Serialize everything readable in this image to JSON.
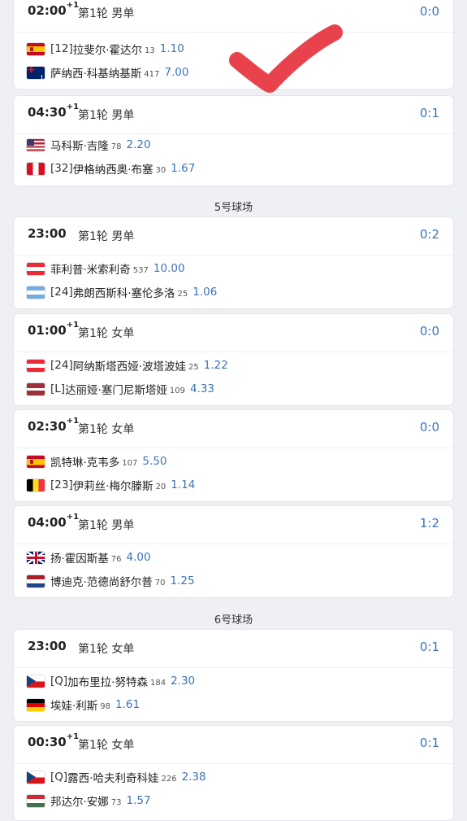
{
  "sections": {
    "court5": "5号球场",
    "court6": "6号球场"
  },
  "matches": [
    {
      "time": "02:00",
      "plus": "+1",
      "round": "第1轮 男单",
      "score": "0:0",
      "p1": {
        "flag": "spain",
        "seed": "[12] ",
        "name": "拉斐尔·霍达尔",
        "rank": "13",
        "odds": "1.10"
      },
      "p2": {
        "flag": "australia",
        "seed": "",
        "name": "萨纳西·科基纳基斯",
        "rank": "417",
        "odds": "7.00"
      }
    },
    {
      "time": "04:30",
      "plus": "+1",
      "round": "第1轮 男单",
      "score": "0:1",
      "p1": {
        "flag": "usa",
        "seed": "",
        "name": "马科斯·吉隆",
        "rank": "78",
        "odds": "2.20"
      },
      "p2": {
        "flag": "peru",
        "seed": "[32] ",
        "name": "伊格纳西奥·布塞",
        "rank": "30",
        "odds": "1.67"
      }
    },
    {
      "time": "23:00",
      "plus": "",
      "round": "第1轮 男单",
      "score": "0:2",
      "p1": {
        "flag": "austria",
        "seed": "",
        "name": "菲利普·米索利奇",
        "rank": "537",
        "odds": "10.00"
      },
      "p2": {
        "flag": "argentina",
        "seed": "[24] ",
        "name": "弗朗西斯科·塞伦多洛",
        "rank": "25",
        "odds": "1.06"
      }
    },
    {
      "time": "01:00",
      "plus": "+1",
      "round": "第1轮 女单",
      "score": "0:0",
      "p1": {
        "flag": "austria",
        "seed": "[24] ",
        "name": "阿纳斯塔西娅·波塔波娃",
        "rank": "25",
        "odds": "1.22"
      },
      "p2": {
        "flag": "latvia",
        "seed": "[L] ",
        "name": "达丽娅·塞门尼斯塔娅",
        "rank": "109",
        "odds": "4.33"
      }
    },
    {
      "time": "02:30",
      "plus": "+1",
      "round": "第1轮 女单",
      "score": "0:0",
      "p1": {
        "flag": "spain",
        "seed": "",
        "name": "凯特琳·克韦多",
        "rank": "107",
        "odds": "5.50"
      },
      "p2": {
        "flag": "belgium",
        "seed": "[23] ",
        "name": "伊莉丝·梅尔滕斯",
        "rank": "20",
        "odds": "1.14"
      }
    },
    {
      "time": "04:00",
      "plus": "+1",
      "round": "第1轮 男单",
      "score": "1:2",
      "p1": {
        "flag": "uk",
        "seed": "",
        "name": "扬·霍因斯基",
        "rank": "76",
        "odds": "4.00"
      },
      "p2": {
        "flag": "netherlands",
        "seed": "",
        "name": "博迪克·范德尚舒尔普",
        "rank": "70",
        "odds": "1.25"
      }
    },
    {
      "time": "23:00",
      "plus": "",
      "round": "第1轮 女单",
      "score": "0:1",
      "p1": {
        "flag": "czech",
        "seed": "[Q] ",
        "name": "加布里拉·努特森",
        "rank": "184",
        "odds": "2.30"
      },
      "p2": {
        "flag": "germany",
        "seed": "",
        "name": "埃娃·利斯",
        "rank": "98",
        "odds": "1.61"
      }
    },
    {
      "time": "00:30",
      "plus": "+1",
      "round": "第1轮 女单",
      "score": "0:1",
      "p1": {
        "flag": "czech",
        "seed": "[Q] ",
        "name": "露西·哈夫利奇科娃",
        "rank": "226",
        "odds": "2.38"
      },
      "p2": {
        "flag": "hungary",
        "seed": "",
        "name": "邦达尔·安娜",
        "rank": "73",
        "odds": "1.57"
      }
    }
  ],
  "colors": {
    "accent": "#3b74b8",
    "checkmark": "#e8434c"
  },
  "annotation_icon": "red-checkmark-icon"
}
